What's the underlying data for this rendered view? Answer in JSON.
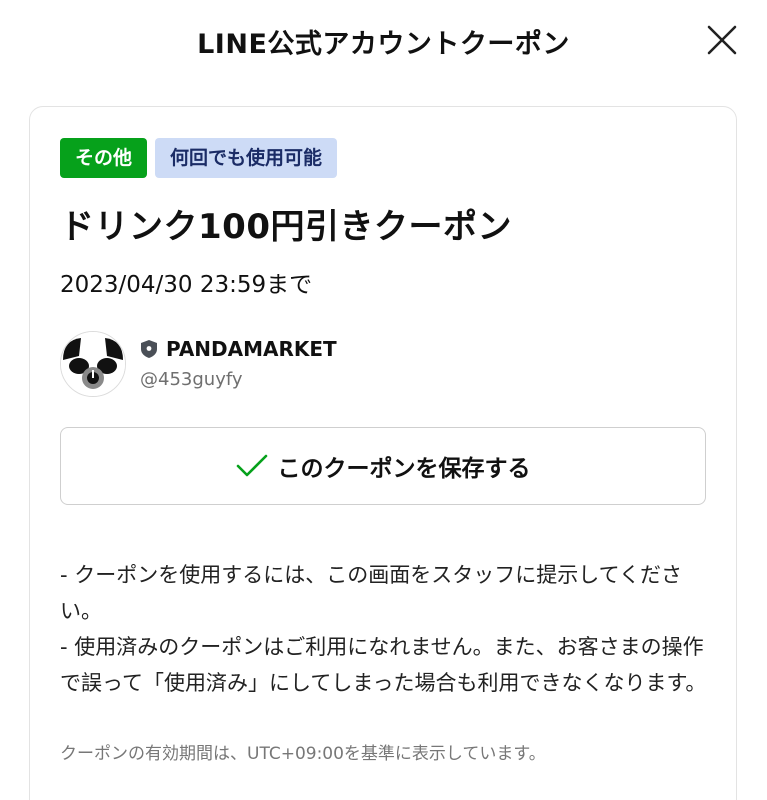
{
  "header": {
    "title": "LINE公式アカウントクーポン",
    "close_icon": "close-icon"
  },
  "coupon": {
    "tags": {
      "category": "その他",
      "usage": "何回でも使用可能"
    },
    "title": "ドリンク100円引きクーポン",
    "expiry": "2023/04/30 23:59まで"
  },
  "account": {
    "name": "PANDAMARKET",
    "id": "@453guyfy",
    "badge_icon": "shield-icon",
    "avatar_icon": "panda-avatar"
  },
  "save_button": {
    "label": "このクーポンを保存する",
    "icon": "checkmark-icon"
  },
  "notes": [
    "- クーポンを使用するには、この画面をスタッフに提示してください。",
    "- 使用済みのクーポンはご利用になれません。また、お客さまの操作で誤って「使用済み」にしてしまった場合も利用できなくなります。"
  ],
  "footnote": "クーポンの有効期間は、UTC+09:00を基準に表示しています。",
  "colors": {
    "category_tag": "#06a11b",
    "usage_tag_bg": "#cddbf6",
    "usage_tag_text": "#1b2c66",
    "check": "#06a11b"
  }
}
